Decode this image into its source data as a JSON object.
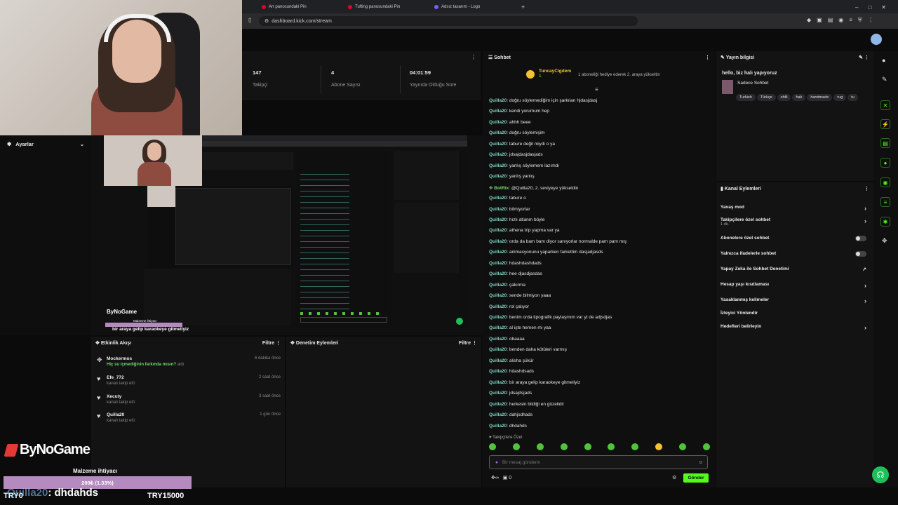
{
  "browser": {
    "tabs": [
      "Art panosundaki Pin",
      "Tufting panosundaki Pin",
      "Adsız tasarım - Logo"
    ],
    "new_tab": "+",
    "url": "dashboard.kick.com/stream"
  },
  "stats": [
    {
      "value": "147",
      "label": "Takipçi"
    },
    {
      "value": "4",
      "label": "Abone Sayısı"
    },
    {
      "value": "04:01:59",
      "label": "Yayında Olduğu Süre"
    }
  ],
  "settings": {
    "title": "Ayarlar"
  },
  "preview": {
    "overlay_text": "bir araya gelip karaokeye gitmeliyiz",
    "logo": "ByNoGame",
    "goal_label": "Malzeme ihtiyacı"
  },
  "activity": {
    "title": "Etkinlik Akışı",
    "filter": "Filtre",
    "items": [
      {
        "name": "Mockermos",
        "detail": "Hiç su içmediğinin farkında mısın?",
        "detail_suffix": "aldı",
        "time": "6 dakika önce"
      },
      {
        "name": "Efe_772",
        "detail": "kanalı takip etti",
        "time": "2 saat önce"
      },
      {
        "name": "Xecuty",
        "detail": "kanalı takip etti",
        "time": "3 saat önce"
      },
      {
        "name": "Quilla20",
        "detail": "kanalı takip etti",
        "time": "1 gün önce"
      }
    ]
  },
  "moderation": {
    "title": "Denetim Eylemleri",
    "filter": "Filtre"
  },
  "overlay": {
    "logo": "ByNoGame",
    "goal_label": "Malzeme ihtiyacı",
    "goal_progress": "200₺ (1.33%)",
    "goal_fraction": 0.0133,
    "goal_current": "TRY0",
    "goal_target": "TRY15000",
    "ticker_user": "Quilla20",
    "ticker_msg": ": dhdahds"
  },
  "chat": {
    "title": "Sohbet",
    "pinned_user": "TuncayCigdem",
    "pinned_badge": "1",
    "pinned_text": "1 aboneliği hediye ederek 2. araya yükseltin",
    "messages": [
      {
        "user": "Quilla20",
        "text": ": doğru söylemediğim için şarkıları hjdasjdasj"
      },
      {
        "user": "Quilla20",
        "text": ": kendi yorumum hep"
      },
      {
        "user": "Quilla20",
        "text": ": ahhh beee"
      },
      {
        "user": "Quilla20",
        "text": ": doğru söylemişim"
      },
      {
        "user": "Quilla20",
        "text": ": tabure değil miydi o ya"
      },
      {
        "user": "Quilla20",
        "text": ": jdsajdasjdasjads"
      },
      {
        "user": "Quilla20",
        "text": ": yanlış söylemem lazımdı"
      },
      {
        "user": "Quilla20",
        "text": ": yanlış yanlış"
      },
      {
        "user": "BotRix",
        "text": ": @Quilla20, 2. seviyeye yükseldin",
        "bot": true
      },
      {
        "user": "Quilla20",
        "text": ": tabure o"
      },
      {
        "user": "Quilla20",
        "text": ": bilmiyorlar"
      },
      {
        "user": "Quilla20",
        "text": ": hızlı atlanm böyle"
      },
      {
        "user": "Quilla20",
        "text": ": athena trip yapma var ya"
      },
      {
        "user": "Quilla20",
        "text": ": orda da bam bam diyor sanıyorlar normalde pam pam mış"
      },
      {
        "user": "Quilla20",
        "text": ": animasyonunu yaparken farkettim dasjadjasds"
      },
      {
        "user": "Quilla20",
        "text": ": hdashdashdads"
      },
      {
        "user": "Quilla20",
        "text": ": hee djasdjasdas"
      },
      {
        "user": "Quilla20",
        "text": ": çakırma"
      },
      {
        "user": "Quilla20",
        "text": ": sende bilmiyon yaaa"
      },
      {
        "user": "Quilla20",
        "text": ": rol çalıyor"
      },
      {
        "user": "Quilla20",
        "text": ": benim orda tipografik paylaşmım var yt de adjsdjas"
      },
      {
        "user": "Quilla20",
        "text": ": al işte hemen mi yaa"
      },
      {
        "user": "Quilla20",
        "text": ": obaaaa"
      },
      {
        "user": "Quilla20",
        "text": ": benden daha kötüleri varmış"
      },
      {
        "user": "Quilla20",
        "text": ": alisha şükür"
      },
      {
        "user": "Quilla20",
        "text": ": hdashdsads"
      },
      {
        "user": "Quilla20",
        "text": ": bir araya gelip karaokeye gitmeliyiz"
      },
      {
        "user": "Quilla20",
        "text": ": jdsajdsjads"
      },
      {
        "user": "Quilla20",
        "text": ": herkesin bildiği en güzelidir"
      },
      {
        "user": "Quilla20",
        "text": ": dahjsdhads"
      },
      {
        "user": "Quilla20",
        "text": ": dhdahds"
      }
    ],
    "followers_only": "Takipçilere Özel",
    "placeholder": "Bir mesaj gönderin",
    "points": "0",
    "send": "Gönder"
  },
  "stream_info": {
    "title": "Yayın bilgisi",
    "stream_title": "hello, biz halı yapıyoruz",
    "category": "Sadece Sohbet",
    "tags": [
      "Turkish",
      "Türkçe",
      "ehlil",
      "halı",
      "handmade",
      "rug",
      "tu"
    ]
  },
  "channel_actions": {
    "title": "Kanal Eylemleri",
    "items": [
      {
        "label": "Yavaş mod",
        "control": "arrow"
      },
      {
        "label": "Takipçilere özel sohbet",
        "sub": "1 dk.",
        "control": "arrow"
      },
      {
        "label": "Abonelere özel sohbet",
        "control": "toggle"
      },
      {
        "label": "Yalnızca ifadelerle sohbet",
        "control": "toggle"
      },
      {
        "label": "Yapay Zeka ile Sohbet Denetimi",
        "control": "ext"
      },
      {
        "label": "Hesap yaşı kısıtlaması",
        "control": "arrow"
      },
      {
        "label": "Yasaklanmış kelimeler",
        "control": "arrow"
      },
      {
        "label": "İzleyici Yönlendir",
        "control": "none"
      },
      {
        "label": "Hedefleri belirleyin",
        "control": "arrow"
      }
    ]
  },
  "colors": {
    "accent": "#53fc18",
    "username": "#7fd4c0",
    "bg": "#0b0b0c"
  }
}
